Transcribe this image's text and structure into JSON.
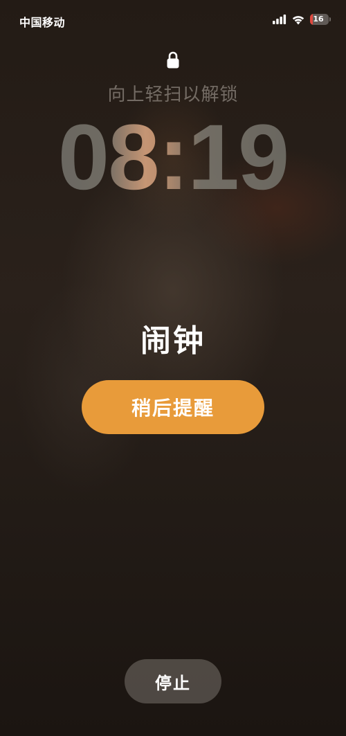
{
  "status_bar": {
    "carrier": "中国移动",
    "signal_icon": "cellular-signal-icon",
    "wifi_icon": "wifi-icon",
    "battery_level": "16",
    "battery_fraction": 0.16,
    "battery_color": "#e0493f"
  },
  "lock_screen": {
    "lock_icon": "lock-icon",
    "unlock_hint": "向上轻扫以解锁",
    "time": "08:19"
  },
  "alarm": {
    "title": "闹钟",
    "snooze_label": "稍后提醒",
    "snooze_color": "#e89b3a",
    "stop_label": "停止"
  }
}
